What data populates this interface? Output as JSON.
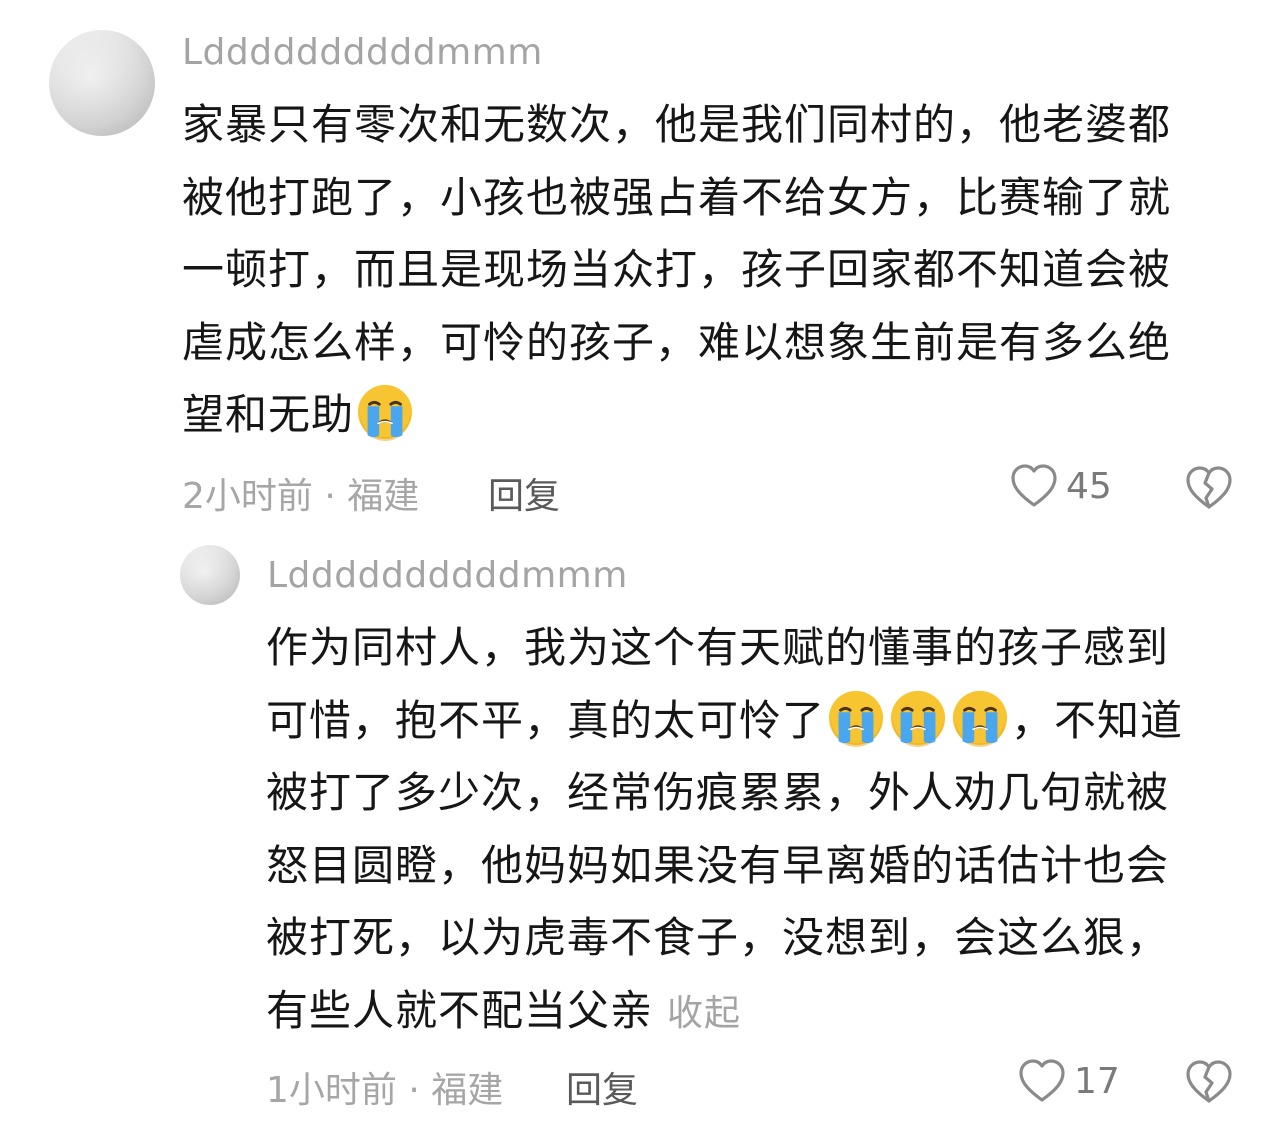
{
  "comment": {
    "username": "Lddddddddddmmm",
    "lines": [
      "家暴只有零次和无数次，他是我们同村的，他老婆都",
      "被他打跑了，小孩也被强占着不给女方，比赛输了就",
      "一顿打，而且是现场当众打，孩子回家都不知道会被",
      "虐成怎么样，可怜的孩子，难以想象生前是有多么绝",
      "望和无助"
    ],
    "emoji": "loudly-crying-face",
    "time": "2小时前",
    "location": "福建",
    "meta_separator": " · ",
    "reply_label": "回复",
    "likes": "45"
  },
  "reply": {
    "username": "Lddddddddddmmm",
    "lines": [
      "作为同村人，我为这个有天赋的懂事的孩子感到",
      "可惜，抱不平，真的太可怜了",
      "，不知道",
      "被打了多少次，经常伤痕累累，外人劝几句就被",
      "怒目圆瞪，他妈妈如果没有早离婚的话估计也会",
      "被打死，以为虎毒不食子，没想到，会这么狠，",
      "有些人就不配当父亲"
    ],
    "collapse_label": "收起",
    "emoji": "loudly-crying-face",
    "time": "1小时前",
    "location": "福建",
    "meta_separator": " · ",
    "reply_label": "回复",
    "likes": "17"
  },
  "colors": {
    "text": "#161616",
    "muted": "#a4a4a4",
    "emoji_face": "#f7c531",
    "emoji_tears": "#4aa6ef"
  }
}
